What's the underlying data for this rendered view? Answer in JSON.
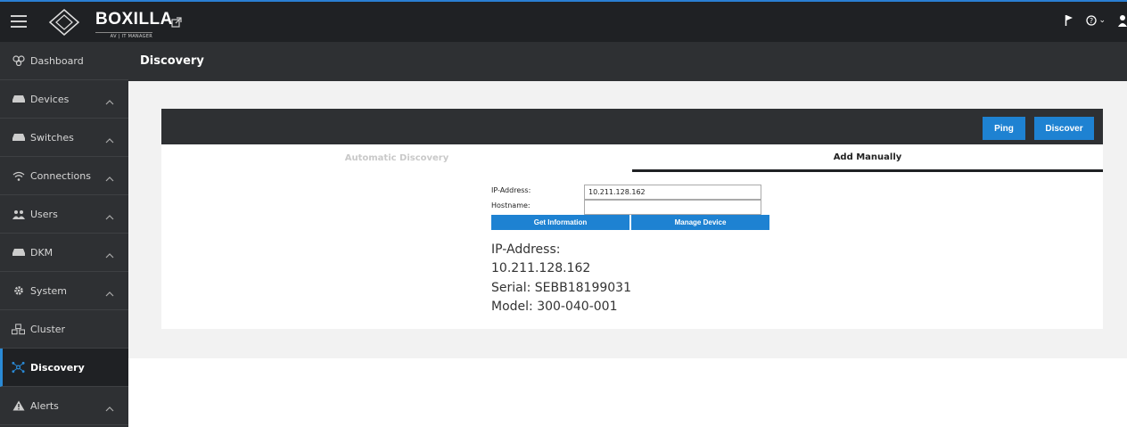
{
  "app": {
    "logo_text": "BOXILLA",
    "logo_subtitle": "AV | IT MANAGER"
  },
  "sidebar": {
    "items": [
      {
        "label": "Dashboard",
        "icon": "dashboard-icon"
      },
      {
        "label": "Devices",
        "icon": "device-icon",
        "chevron": "︿"
      },
      {
        "label": "Switches",
        "icon": "switch-icon",
        "chevron": "︿"
      },
      {
        "label": "Connections",
        "icon": "wifi-icon",
        "chevron": "︿"
      },
      {
        "label": "Users",
        "icon": "users-icon",
        "chevron": "︿"
      },
      {
        "label": "DKM",
        "icon": "dkm-icon",
        "chevron": "︿"
      },
      {
        "label": "System",
        "icon": "gear-icon",
        "chevron": "︿"
      },
      {
        "label": "Cluster",
        "icon": "cluster-icon"
      },
      {
        "label": "Discovery",
        "icon": "discovery-icon",
        "active": true
      },
      {
        "label": "Alerts",
        "icon": "warning-icon",
        "chevron": "︿"
      }
    ]
  },
  "page": {
    "title": "Discovery"
  },
  "panel": {
    "ping_label": "Ping",
    "discover_label": "Discover",
    "tabs": [
      {
        "label": "Automatic Discovery",
        "active": false
      },
      {
        "label": "Add Manually",
        "active": true
      }
    ]
  },
  "form": {
    "ip_label": "IP-Address:",
    "ip_value": "10.211.128.162",
    "hostname_label": "Hostname:",
    "hostname_value": "",
    "get_info_label": "Get Information",
    "manage_device_label": "Manage Device"
  },
  "device_info": {
    "line1": "IP-Address:",
    "line2": "10.211.128.162",
    "line3": "Serial: SEBB18199031",
    "line4": "Model: 300-040-001"
  },
  "colors": {
    "accent": "#1e82d2",
    "topbar": "#1f2124",
    "sidebar": "#2e3033"
  }
}
